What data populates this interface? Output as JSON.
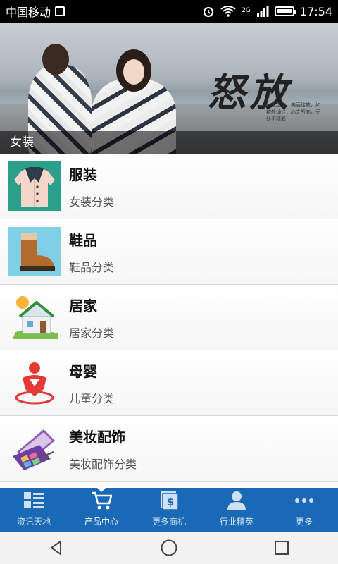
{
  "status_bar": {
    "carrier": "中国移动",
    "network": "2G",
    "time": "17:54"
  },
  "banner": {
    "caption": "女装",
    "art_text": "怒放",
    "art_subtext": "一生之中，美丽绽放，如花般灿烂，心之所向，无处不精彩"
  },
  "categories": [
    {
      "title": "服装",
      "subtitle": "女装分类",
      "icon": "jacket-icon"
    },
    {
      "title": "鞋品",
      "subtitle": "鞋品分类",
      "icon": "boot-icon"
    },
    {
      "title": "居家",
      "subtitle": "居家分类",
      "icon": "house-icon"
    },
    {
      "title": "母婴",
      "subtitle": "儿童分类",
      "icon": "baby-icon"
    },
    {
      "title": "美妆配饰",
      "subtitle": "美妆配饰分类",
      "icon": "makeup-palette-icon"
    }
  ],
  "tabbar": {
    "tabs": [
      {
        "label": "资讯天地",
        "icon": "news-list-icon"
      },
      {
        "label": "产品中心",
        "icon": "shopping-cart-icon",
        "active": true
      },
      {
        "label": "更多商机",
        "icon": "dollar-document-icon"
      },
      {
        "label": "行业精英",
        "icon": "person-icon"
      },
      {
        "label": "更多",
        "icon": "more-dots-icon"
      }
    ]
  },
  "colors": {
    "tabbar_bg": "#1a69b7",
    "statusbar_bg": "#000000"
  }
}
